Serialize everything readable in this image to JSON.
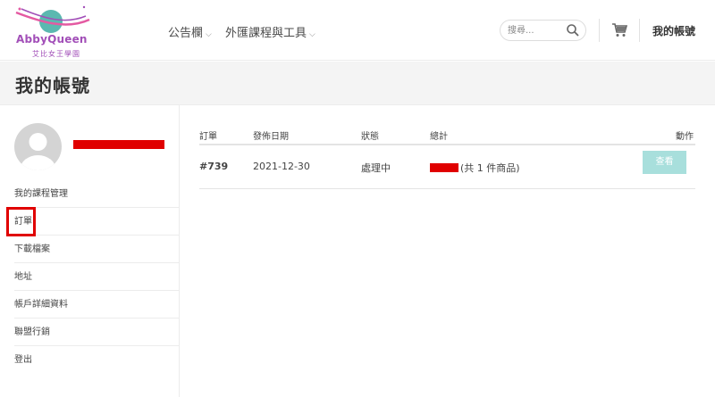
{
  "brand": {
    "logo_text": "AbbyQueen",
    "logo_subtext": "艾比女王學園",
    "colors": {
      "purple": "#a24fb8",
      "pink": "#e45aa2",
      "teal": "#5bb8b0"
    }
  },
  "nav": {
    "items": [
      {
        "label": "公告欄",
        "icon": "chevron-down-icon"
      },
      {
        "label": "外匯課程與工具",
        "icon": "chevron-down-icon"
      }
    ],
    "search_placeholder": "搜尋...",
    "search_icon": "search-icon",
    "cart_icon": "cart-icon",
    "account_label": "我的帳號"
  },
  "page_title": "我的帳號",
  "sidebar": {
    "avatar_icon": "user-avatar",
    "items": [
      {
        "label": "我的課程管理"
      },
      {
        "label": "訂單"
      },
      {
        "label": "下載檔案"
      },
      {
        "label": "地址"
      },
      {
        "label": "帳戶詳細資料"
      },
      {
        "label": "聯盟行銷"
      },
      {
        "label": "登出"
      }
    ],
    "highlighted_item": "訂單"
  },
  "orders": {
    "headers": {
      "order": "訂單",
      "date": "發佈日期",
      "status": "狀態",
      "total": "總計",
      "action": "動作"
    },
    "rows": [
      {
        "order_no": "#739",
        "date": "2021-12-30",
        "status": "處理中",
        "total_suffix": "(共 1 件商品)",
        "action_label": "查看"
      }
    ],
    "accent": "#a8dfdc",
    "redaction_color": "#e00000"
  }
}
